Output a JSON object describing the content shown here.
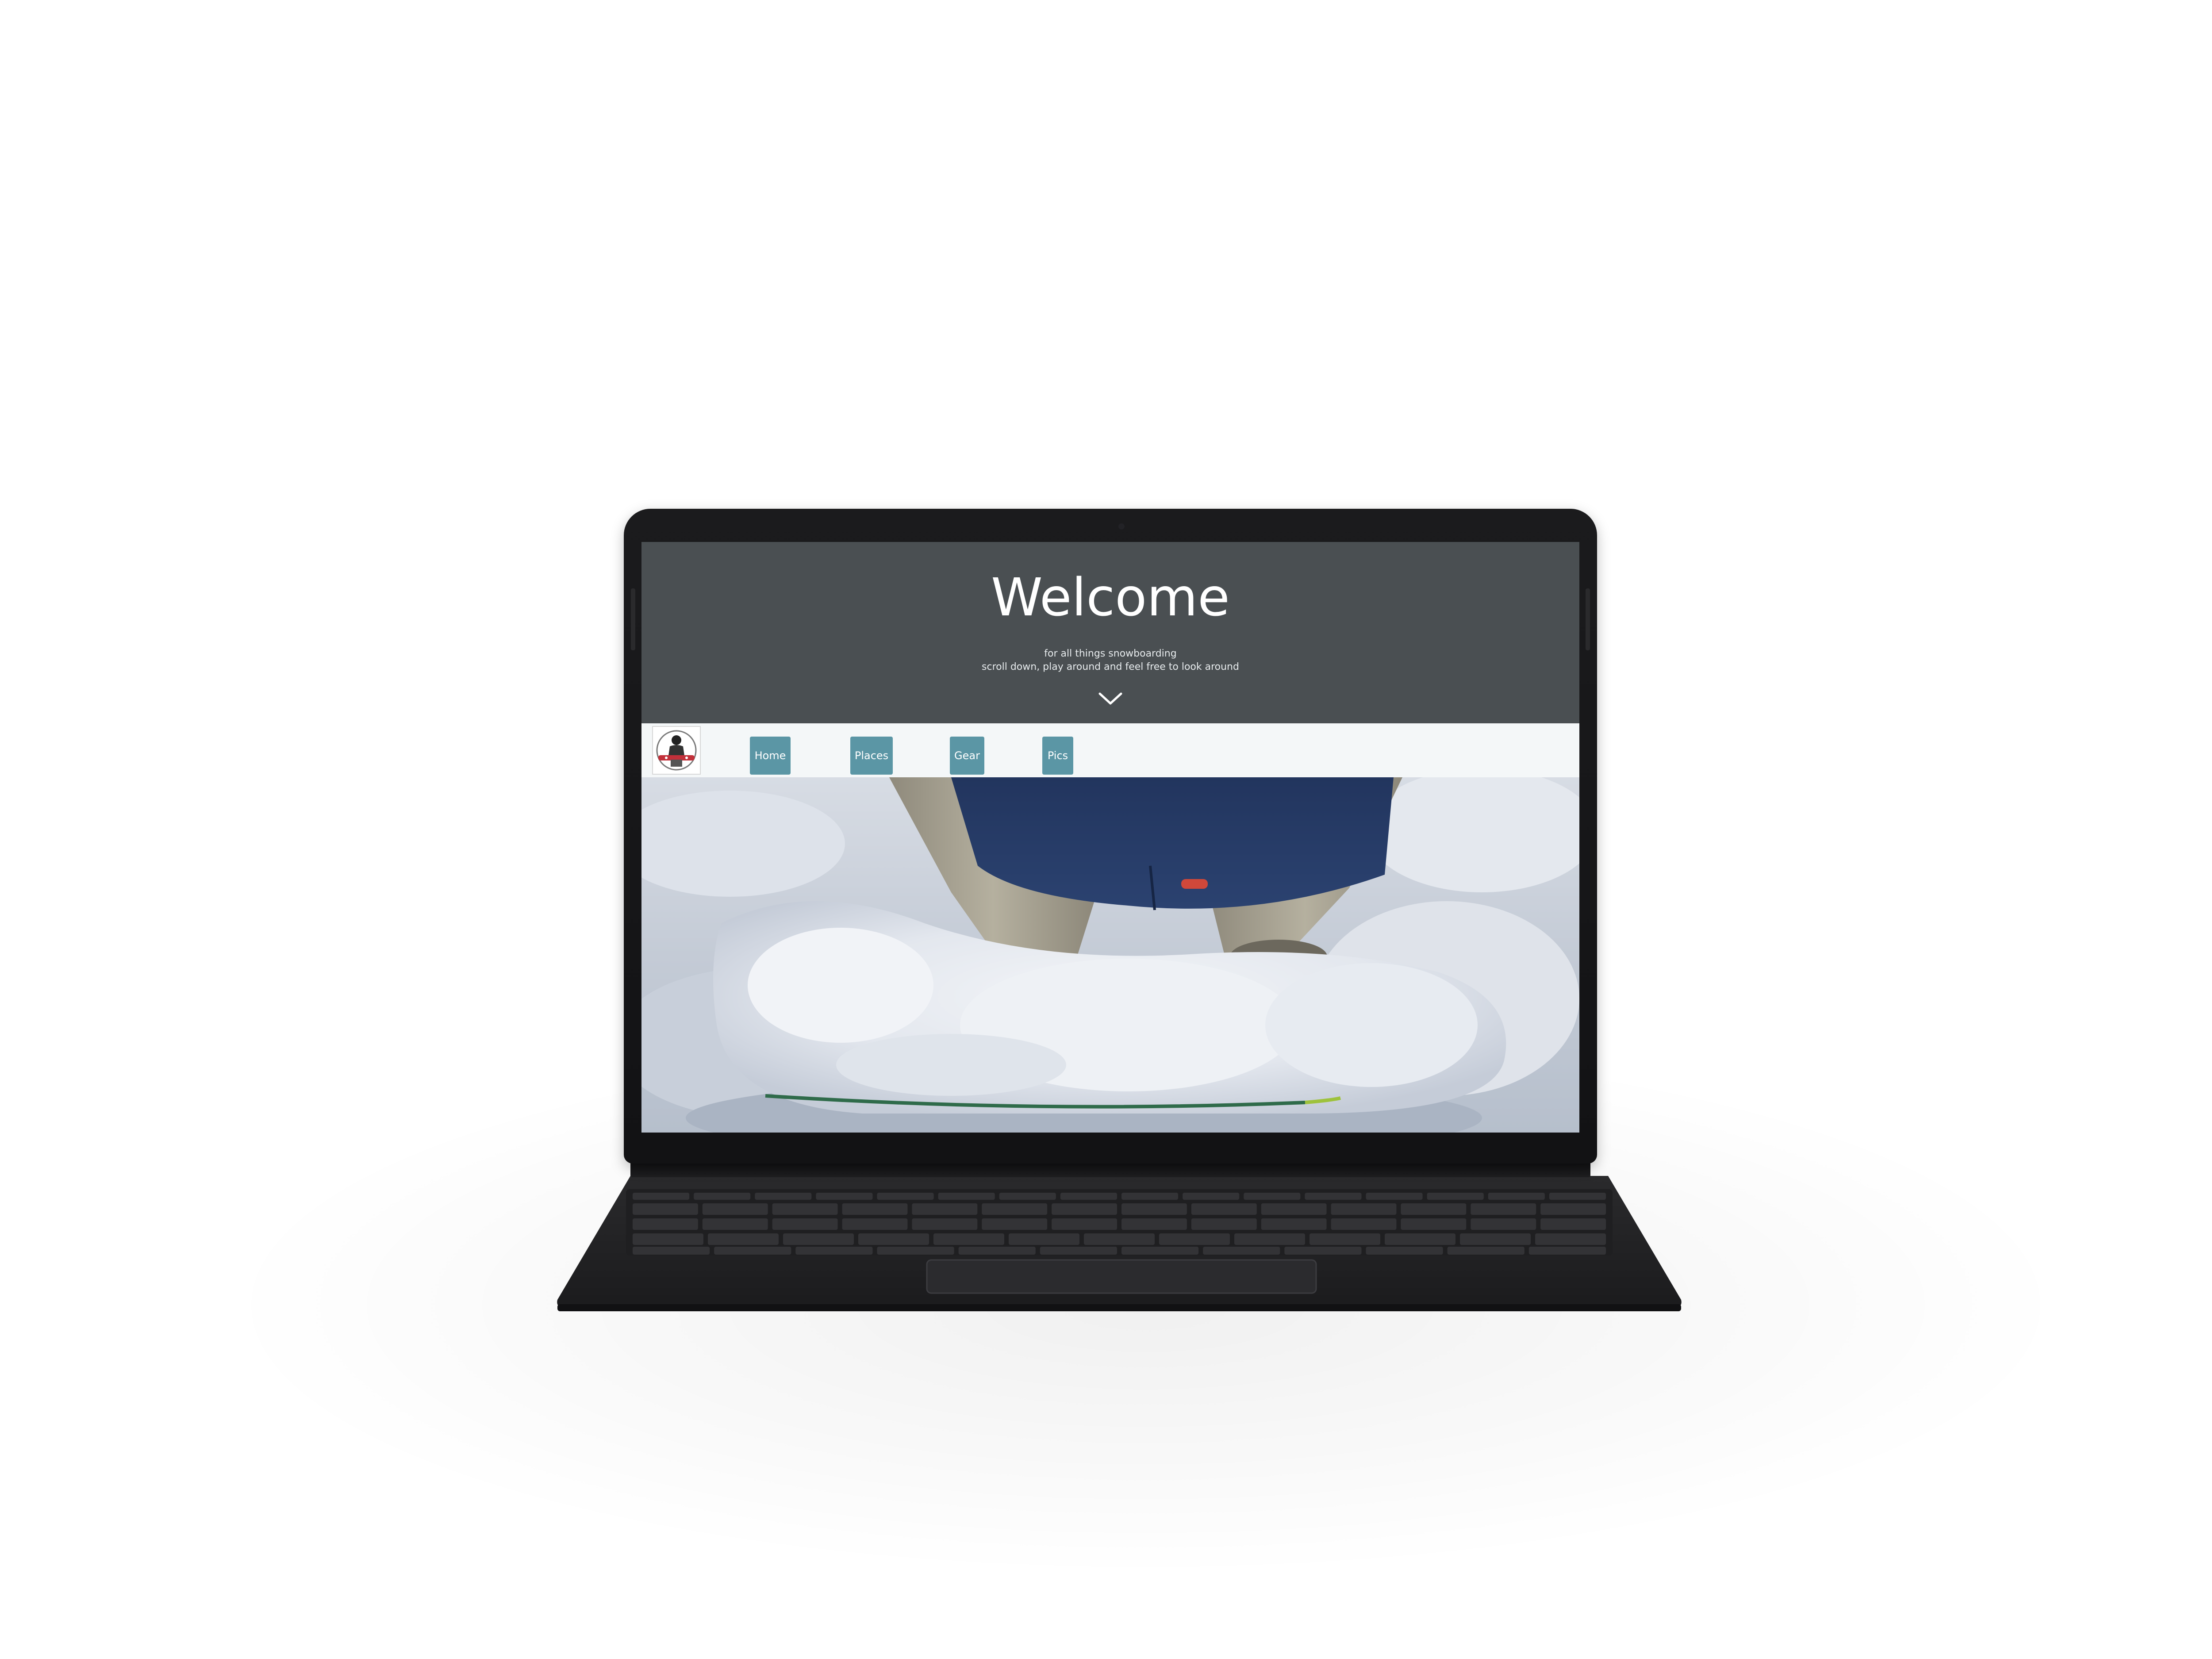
{
  "hero": {
    "title": "Welcome",
    "subtitle_line1": "for all things snowboarding",
    "subtitle_line2": "scroll down, play around and feel free to look around",
    "scroll_icon": "chevron-down-icon"
  },
  "nav": {
    "logo_icon": "snowboarder-logo-icon",
    "items": [
      {
        "label": "Home"
      },
      {
        "label": "Places"
      },
      {
        "label": "Gear"
      },
      {
        "label": "Pics"
      }
    ]
  },
  "colors": {
    "hero_bg": "#4a4f52",
    "nav_bg": "#f4f7f8",
    "nav_button": "#5b96a5",
    "device_frame": "#151517"
  },
  "hero_image": {
    "subject": "snowboard buried in powder snow"
  }
}
